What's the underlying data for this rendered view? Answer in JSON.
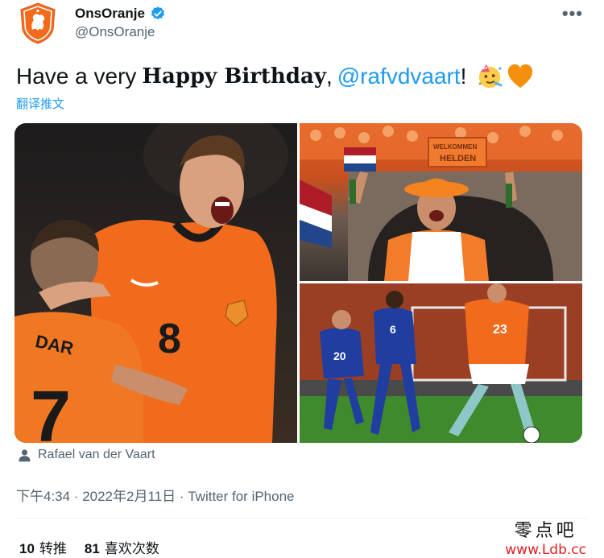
{
  "account": {
    "display_name": "OnsOranje",
    "handle": "@OnsOranje",
    "verified_icon": "verified-badge-icon"
  },
  "tweet": {
    "text_prefix": "Have a very",
    "text_bold": "Happy Birthday",
    "comma": ",",
    "mention": "@rafvdvaart",
    "exclam": "!",
    "emojis": [
      "party-face-emoji",
      "orange-heart-emoji"
    ],
    "translate_label": "翻译推文"
  },
  "media": {
    "tagged_person": "Rafael van der Vaart",
    "photos": [
      {
        "name": "celebration-photo",
        "jersey": "8"
      },
      {
        "name": "fans-canal-photo",
        "banner": "WELKOMMEN HELDEN"
      },
      {
        "name": "match-action-photo",
        "jerseys": [
          "20",
          "6",
          "23"
        ]
      }
    ]
  },
  "meta": {
    "time_source": "下午4:34 · 2022年2月11日 · Twitter for iPhone"
  },
  "stats": {
    "retweets_count": "10",
    "retweets_label": "转推",
    "likes_count": "81",
    "likes_label": "喜欢次数"
  },
  "watermark": {
    "chinese": "零点吧",
    "url": "www.Ldb.cc"
  },
  "colors": {
    "accent": "#1d9bf0",
    "secondary_text": "#536471",
    "primary_text": "#0f1419",
    "kit_orange": "#f26b1d"
  }
}
